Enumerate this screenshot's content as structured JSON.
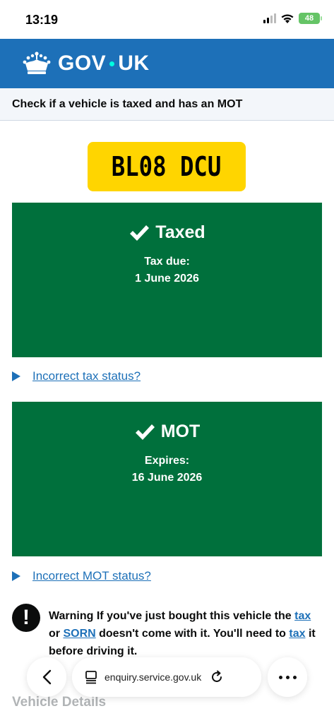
{
  "status_bar": {
    "time": "13:19",
    "battery": "48"
  },
  "header": {
    "logo_left": "GOV",
    "logo_right": "UK"
  },
  "service": {
    "name": "Check if a vehicle is taxed and has an MOT"
  },
  "vehicle": {
    "registration": "BL08 DCU"
  },
  "tax_panel": {
    "title": "Taxed",
    "label": "Tax due:",
    "date": "1 June 2026"
  },
  "mot_panel": {
    "title": "MOT",
    "label": "Expires:",
    "date": "16 June 2026"
  },
  "links": {
    "incorrect_tax": "Incorrect tax status?",
    "incorrect_mot": "Incorrect MOT status?"
  },
  "warning": {
    "icon": "!",
    "part1": "Warning If you've just bought this vehicle the ",
    "link_tax": "tax",
    "part2": " or ",
    "link_sorn": "SORN",
    "part3": " doesn't come with it. You'll need to ",
    "link_tax2": "tax",
    "part4": " it before driving it."
  },
  "section": {
    "vehicle_details": "Vehicle Details"
  },
  "browser": {
    "url": "enquiry.service.gov.uk"
  },
  "colors": {
    "govuk_blue": "#1d70b8",
    "success_green": "#00703c",
    "plate_yellow": "#ffd500"
  }
}
